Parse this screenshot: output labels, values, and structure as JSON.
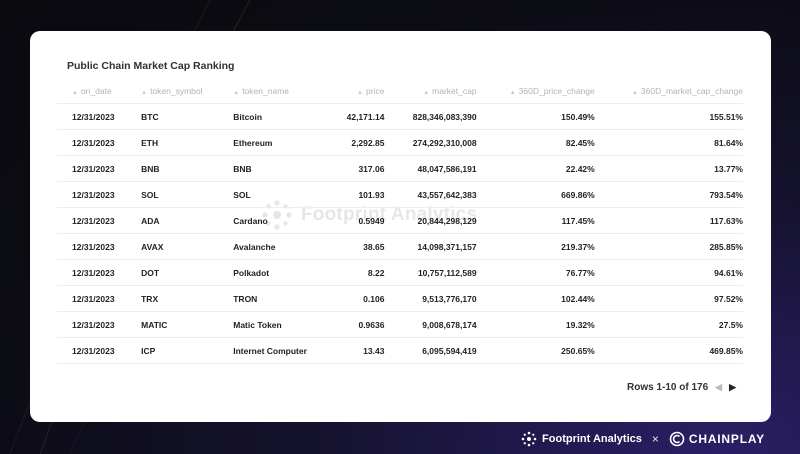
{
  "card": {
    "title": "Public Chain Market Cap Ranking",
    "watermark": "Footprint Analytics"
  },
  "table": {
    "columns": [
      "on_date",
      "token_symbol",
      "token_name",
      "price",
      "market_cap",
      "360D_price_change",
      "360D_market_cap_change"
    ],
    "rows": [
      [
        "12/31/2023",
        "BTC",
        "Bitcoin",
        "42,171.14",
        "828,346,083,390",
        "150.49%",
        "155.51%"
      ],
      [
        "12/31/2023",
        "ETH",
        "Ethereum",
        "2,292.85",
        "274,292,310,008",
        "82.45%",
        "81.64%"
      ],
      [
        "12/31/2023",
        "BNB",
        "BNB",
        "317.06",
        "48,047,586,191",
        "22.42%",
        "13.77%"
      ],
      [
        "12/31/2023",
        "SOL",
        "SOL",
        "101.93",
        "43,557,642,383",
        "669.86%",
        "793.54%"
      ],
      [
        "12/31/2023",
        "ADA",
        "Cardano",
        "0.5949",
        "20,844,298,129",
        "117.45%",
        "117.63%"
      ],
      [
        "12/31/2023",
        "AVAX",
        "Avalanche",
        "38.65",
        "14,098,371,157",
        "219.37%",
        "285.85%"
      ],
      [
        "12/31/2023",
        "DOT",
        "Polkadot",
        "8.22",
        "10,757,112,589",
        "76.77%",
        "94.61%"
      ],
      [
        "12/31/2023",
        "TRX",
        "TRON",
        "0.106",
        "9,513,776,170",
        "102.44%",
        "97.52%"
      ],
      [
        "12/31/2023",
        "MATIC",
        "Matic Token",
        "0.9636",
        "9,008,678,174",
        "19.32%",
        "27.5%"
      ],
      [
        "12/31/2023",
        "ICP",
        "Internet Computer",
        "13.43",
        "6,095,594,419",
        "250.65%",
        "469.85%"
      ]
    ]
  },
  "pagination": {
    "label": "Rows 1-10 of 176",
    "prev_icon": "chevron-left-icon",
    "next_icon": "chevron-right-icon"
  },
  "footer": {
    "brand1": "Footprint Analytics",
    "separator": "×",
    "brand2": "CHAINPLAY"
  },
  "colors": {
    "background": "#0b0b12",
    "accent_glow": "#2a1f66",
    "card": "#ffffff",
    "header_text": "#b1b3b8",
    "body_text": "#222222"
  }
}
